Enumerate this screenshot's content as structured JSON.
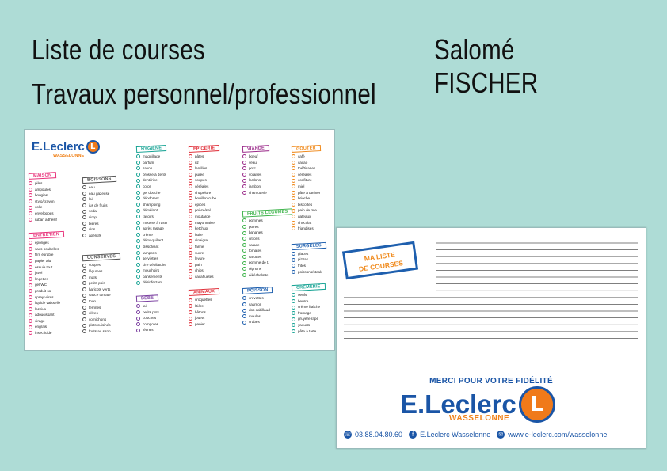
{
  "header": {
    "title1": "Liste de courses",
    "title2": "Travaux personnel/professionnel",
    "author": "Salomé FISCHER"
  },
  "logo": {
    "brand": "E.Leclerc",
    "letter": "L",
    "town": "WASSELONNE"
  },
  "columns": [
    [
      {
        "name": "MAISON",
        "color": "#e8327a",
        "items": [
          "piles",
          "ampoules",
          "bougies",
          "stylo/crayon",
          "colle",
          "enveloppes",
          "ruban adhésif"
        ]
      },
      {
        "name": "ENTRETIEN",
        "color": "#e8327a",
        "items": [
          "éponges",
          "sacs poubelles",
          "film étirable",
          "papier alu",
          "essuie tout",
          "javel",
          "lingettes",
          "gel WC",
          "produit sol",
          "spray vitres",
          "liquide vaisselle",
          "lessive",
          "adoucissant",
          "cirage",
          "engrais",
          "insecticide"
        ]
      }
    ],
    [
      {
        "name": "BOISSONS",
        "color": "#555555",
        "items": [
          "eau",
          "eau gazeuse",
          "lait",
          "jus de fruits",
          "soda",
          "sirop",
          "bières",
          "vins",
          "apéritifs"
        ]
      },
      {
        "name": "CONSERVES",
        "color": "#555555",
        "items": [
          "soupes",
          "légumes",
          "maïs",
          "petits pois",
          "haricots verts",
          "sauce tomate",
          "thon",
          "terrines",
          "olives",
          "cornichons",
          "plats cuisinés",
          "fruits au sirop"
        ]
      }
    ],
    [
      {
        "name": "HYGIÈNE",
        "color": "#17a394",
        "items": [
          "maquillage",
          "parfum",
          "savon",
          "brosse à dents",
          "dentifrice",
          "coton",
          "gel douche",
          "déodorant",
          "shampoing",
          "démêlant",
          "rasoirs",
          "mousse à raser",
          "après rasage",
          "crème",
          "démaquillant",
          "dissolvant",
          "tampons",
          "serviettes",
          "cire dépilatoire",
          "mouchoirs",
          "pansements",
          "désinfectant"
        ]
      },
      {
        "name": "BÉBÉ",
        "color": "#7a3fa0",
        "items": [
          "lait",
          "petits pots",
          "couches",
          "compotes",
          "tétines"
        ]
      }
    ],
    [
      {
        "name": "ÉPICERIE",
        "color": "#e0303a",
        "items": [
          "pâtes",
          "riz",
          "lentilles",
          "purée",
          "soupes",
          "céréales",
          "chapelure",
          "bouillon cube",
          "épices",
          "poivre/sel",
          "moutarde",
          "mayonnaise",
          "ketchup",
          "huile",
          "vinaigre",
          "farine",
          "sucre",
          "levure",
          "pain",
          "chips",
          "cacahuètes"
        ]
      },
      {
        "name": "ANIMAUX",
        "color": "#e0303a",
        "items": [
          "croquettes",
          "litière",
          "bâtons",
          "jouets",
          "panier"
        ]
      }
    ],
    [
      {
        "name": "VIANDE",
        "color": "#9b2b8a",
        "items": [
          "boeuf",
          "veau",
          "porc",
          "volailles",
          "lardons",
          "jambon",
          "charcuterie"
        ]
      },
      {
        "name": "FRUITS LÉGUMES",
        "color": "#3db34a",
        "items": [
          "pommes",
          "poires",
          "bananes",
          "citrons",
          "salade",
          "tomates",
          "carottes",
          "pomme de t.",
          "oignons",
          "ail/échalotte"
        ]
      },
      {
        "name": "POISSON",
        "color": "#1e5fae",
        "items": [
          "crevettes",
          "saumon",
          "dos cabillaud",
          "moules",
          "crabes"
        ]
      }
    ],
    [
      {
        "name": "GOÛTER",
        "color": "#f08a1c",
        "items": [
          "café",
          "cacao",
          "thé/tisanes",
          "céréales",
          "confiture",
          "miel",
          "pâte à tartiner",
          "brioche",
          "biscottes",
          "pain de mie",
          "gateaux",
          "chocolat",
          "friandises"
        ]
      },
      {
        "name": "SURGELÉS",
        "color": "#1e5fae",
        "items": [
          "glaces",
          "pizzas",
          "frites",
          "poissons/steak"
        ]
      },
      {
        "name": "CRÉMERIE",
        "color": "#17a394",
        "items": [
          "oeufs",
          "beurre",
          "crème fraîche",
          "fromage",
          "gruyère rapé",
          "yaourts",
          "pâte à tarte"
        ]
      }
    ]
  ],
  "back": {
    "boxText1": "MA LISTE",
    "boxText2": "DE COURSES",
    "merci": "MERCI POUR VOTRE FIDÉLITÉ",
    "phone": "03.88.04.80.60",
    "facebook": "E.Leclerc Wasselonne",
    "web": "www.e-leclerc.com/wasselonne"
  },
  "colors": {
    "background": "#aedcd6",
    "brand_blue": "#1a55a6",
    "brand_orange": "#f0821a"
  }
}
